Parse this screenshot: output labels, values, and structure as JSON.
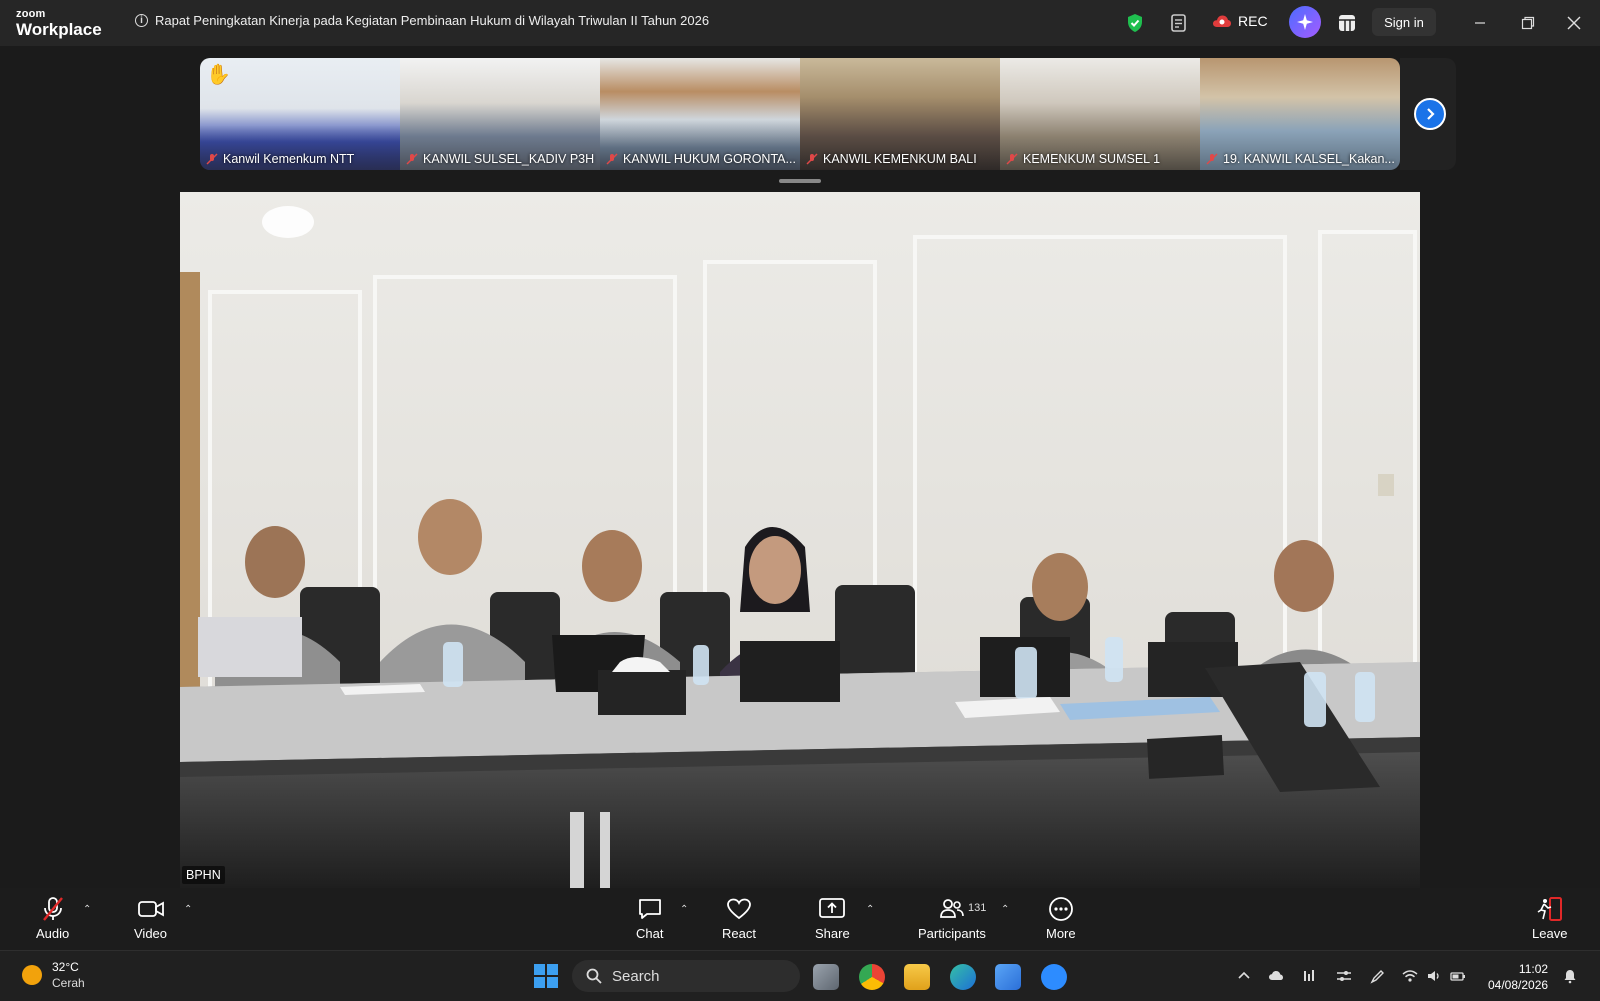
{
  "app": {
    "brand_top": "zoom",
    "brand_bottom": "Workplace",
    "meeting_title": "Rapat Peningkatan Kinerja pada Kegiatan Pembinaan Hukum di Wilayah Triwulan II Tahun 2026",
    "rec_label": "REC",
    "sign_in_label": "Sign in"
  },
  "participants_strip": [
    {
      "name": "Kanwil Kemenkum NTT",
      "hand_raised": true,
      "muted": true
    },
    {
      "name": "KANWIL SULSEL_KADIV P3H",
      "hand_raised": false,
      "muted": true
    },
    {
      "name": "KANWIL HUKUM GORONTA...",
      "hand_raised": false,
      "muted": true
    },
    {
      "name": "KANWIL KEMENKUM BALI",
      "hand_raised": false,
      "muted": true
    },
    {
      "name": "KEMENKUM SUMSEL 1",
      "hand_raised": false,
      "muted": true
    },
    {
      "name": "19. KANWIL KALSEL_Kakan...",
      "hand_raised": false,
      "muted": true
    }
  ],
  "main_video": {
    "speaker_name": "BPHN"
  },
  "toolbar": {
    "audio_label": "Audio",
    "video_label": "Video",
    "chat_label": "Chat",
    "react_label": "React",
    "share_label": "Share",
    "participants_label": "Participants",
    "participants_count": "131",
    "more_label": "More",
    "leave_label": "Leave"
  },
  "taskbar": {
    "temperature": "32°C",
    "weather": "Cerah",
    "search_placeholder": "Search",
    "time": "11:02",
    "date": "04/08/2026"
  },
  "colors": {
    "accent_blue": "#1a73e8",
    "leave_red": "#e02828",
    "shield_green": "#1fbf4f",
    "rec_red": "#e03c3c"
  }
}
